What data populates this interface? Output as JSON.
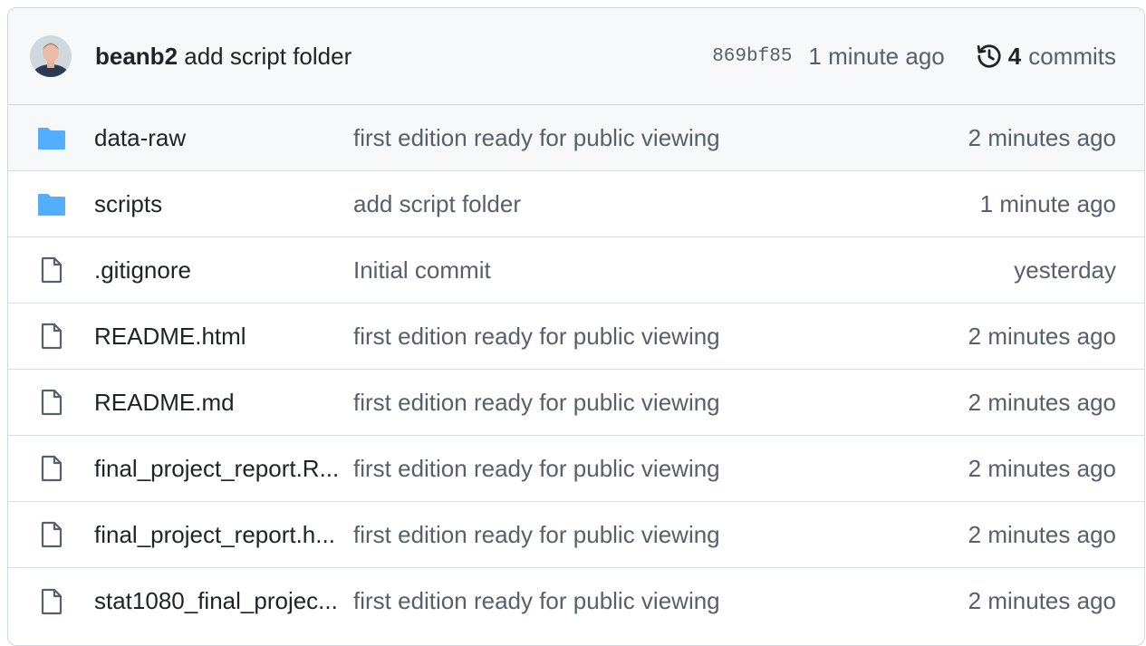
{
  "latest_commit": {
    "author": "beanb2",
    "message": "add script folder",
    "sha": "869bf85",
    "time": "1 minute ago",
    "commit_count": "4",
    "commits_label": "commits"
  },
  "files": [
    {
      "type": "folder",
      "icon": "folder-icon",
      "name": "data-raw",
      "message": "first edition ready for public viewing",
      "age": "2 minutes ago"
    },
    {
      "type": "folder",
      "icon": "folder-icon",
      "name": "scripts",
      "message": "add script folder",
      "age": "1 minute ago"
    },
    {
      "type": "file",
      "icon": "file-icon",
      "name": ".gitignore",
      "message": "Initial commit",
      "age": "yesterday"
    },
    {
      "type": "file",
      "icon": "file-icon",
      "name": "README.html",
      "message": "first edition ready for public viewing",
      "age": "2 minutes ago"
    },
    {
      "type": "file",
      "icon": "file-icon",
      "name": "README.md",
      "message": "first edition ready for public viewing",
      "age": "2 minutes ago"
    },
    {
      "type": "file",
      "icon": "file-icon",
      "name": "final_project_report.R...",
      "message": "first edition ready for public viewing",
      "age": "2 minutes ago"
    },
    {
      "type": "file",
      "icon": "file-icon",
      "name": "final_project_report.h...",
      "message": "first edition ready for public viewing",
      "age": "2 minutes ago"
    },
    {
      "type": "file",
      "icon": "file-icon",
      "name": "stat1080_final_projec...",
      "message": "first edition ready for public viewing",
      "age": "2 minutes ago"
    }
  ],
  "colors": {
    "folder": "#54aeff",
    "file_icon": "#57606a",
    "header_bg": "#f6f8fa",
    "border": "#d0d7de"
  }
}
